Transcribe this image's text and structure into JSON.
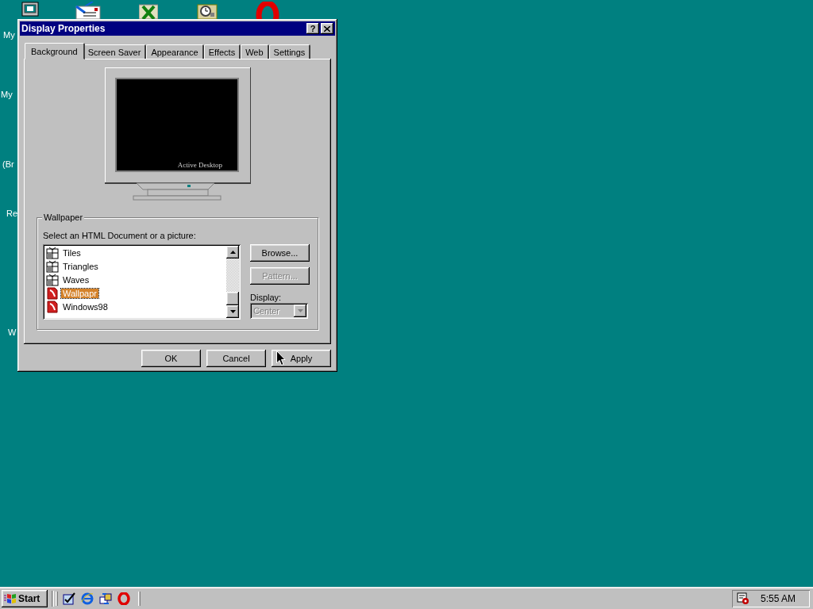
{
  "desktop_labels": [
    "My",
    "My",
    "(Br",
    "Re",
    "W"
  ],
  "window": {
    "title": "Display Properties",
    "help_button": "?"
  },
  "tabs": [
    {
      "label": "Background",
      "selected": true
    },
    {
      "label": "Screen Saver",
      "selected": false
    },
    {
      "label": "Appearance",
      "selected": false
    },
    {
      "label": "Effects",
      "selected": false
    },
    {
      "label": "Web",
      "selected": false
    },
    {
      "label": "Settings",
      "selected": false
    }
  ],
  "preview": {
    "caption": "Active Desktop"
  },
  "wallpaper": {
    "legend": "Wallpaper",
    "prompt": "Select an HTML Document or a picture:",
    "items": [
      {
        "label": "Tiles",
        "kind": "image",
        "selected": false
      },
      {
        "label": "Triangles",
        "kind": "image",
        "selected": false
      },
      {
        "label": "Waves",
        "kind": "image",
        "selected": false
      },
      {
        "label": "Wallpapr",
        "kind": "html",
        "selected": true
      },
      {
        "label": "Windows98",
        "kind": "html",
        "selected": false
      }
    ],
    "browse_button": {
      "label": "Browse...",
      "disabled": false
    },
    "pattern_button": {
      "label": "Pattern...",
      "disabled": true
    },
    "display_label": "Display:",
    "display_select": {
      "value": "Center",
      "disabled": true
    }
  },
  "buttons": [
    {
      "label": "OK"
    },
    {
      "label": "Cancel"
    },
    {
      "label": "Apply"
    }
  ],
  "taskbar": {
    "start": "Start",
    "clock": "5:55 AM"
  }
}
